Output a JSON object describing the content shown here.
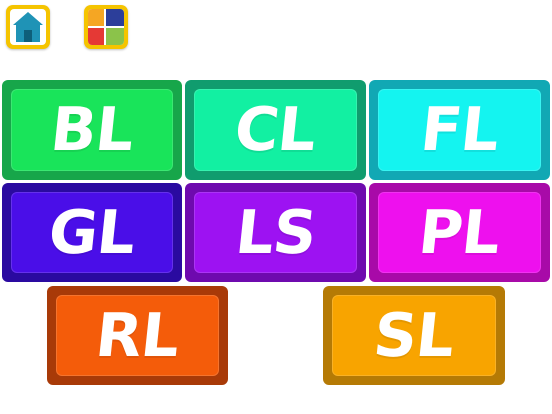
{
  "toolbar": {
    "home_icon": "house-icon",
    "menu_icon": "grid-menu-icon",
    "colors": {
      "frame": "#f5c400",
      "house": "#1f93b6",
      "house_door": "#0e5f7a",
      "grid_blue": "#2c3e9a",
      "grid_green": "#8bc34a",
      "grid_red": "#e53935",
      "grid_orange": "#f5a623"
    }
  },
  "tiles": [
    {
      "label": "BL",
      "outer": "#17a64a",
      "face": "#19e45a"
    },
    {
      "label": "CL",
      "outer": "#109c6e",
      "face": "#12f0a2"
    },
    {
      "label": "FL",
      "outer": "#11a8b4",
      "face": "#14f4f0"
    },
    {
      "label": "GL",
      "outer": "#2a0aa0",
      "face": "#4a0ee8"
    },
    {
      "label": "LS",
      "outer": "#6e0aae",
      "face": "#9d12f2"
    },
    {
      "label": "PL",
      "outer": "#a80aa8",
      "face": "#ee10ee"
    },
    {
      "label": "RL",
      "outer": "#a83a08",
      "face": "#f45c0a"
    },
    {
      "label": "SL",
      "outer": "#b57a05",
      "face": "#f8a400"
    }
  ]
}
